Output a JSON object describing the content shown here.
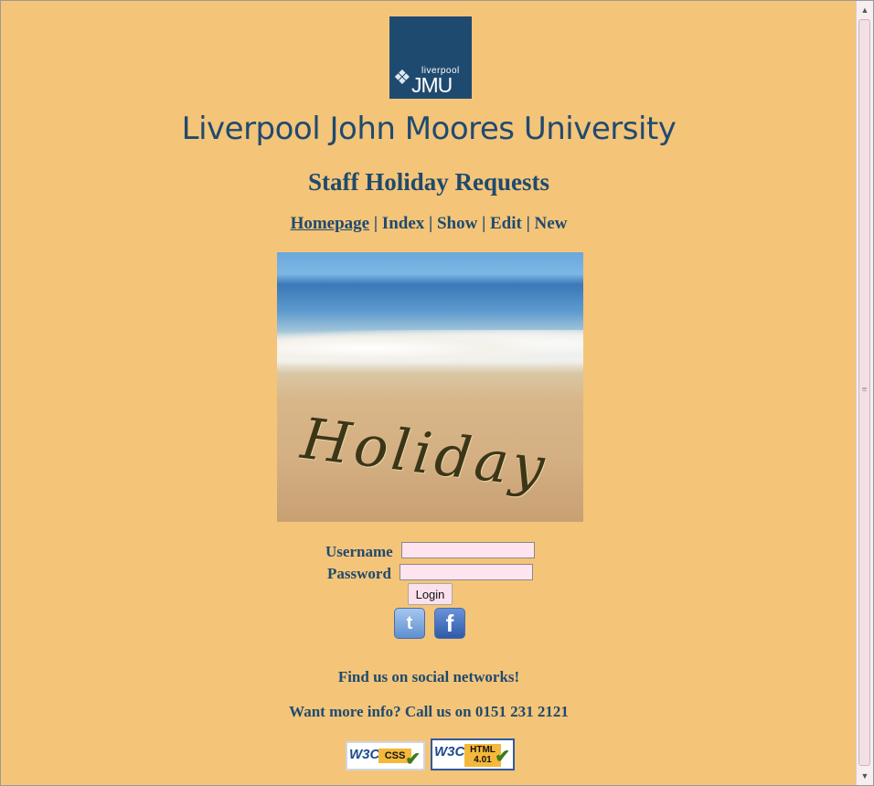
{
  "logo": {
    "small_text": "liverpool",
    "big_text": "JMU"
  },
  "university_title": "Liverpool John Moores University",
  "app_title": "Staff Holiday Requests",
  "nav": {
    "items": [
      "Homepage",
      "Index",
      "Show",
      "Edit",
      "New"
    ],
    "separator": "|",
    "active": "Homepage"
  },
  "hero": {
    "word": "Holiday"
  },
  "login": {
    "username_label": "Username",
    "password_label": "Password",
    "username_value": "",
    "password_value": "",
    "button_label": "Login"
  },
  "social": {
    "twitter_glyph": "t",
    "facebook_glyph": "f"
  },
  "find_us": "Find us on social networks!",
  "more_info": "Want more info? Call us on 0151 231 2121",
  "badges": {
    "css": {
      "w3c": "W3C",
      "text": "CSS"
    },
    "html": {
      "w3c": "W3C",
      "text_line1": "HTML",
      "text_line2": "4.01"
    }
  },
  "colors": {
    "background": "#f4c478",
    "text": "#1f4a6e",
    "input_bg": "#fde4ee"
  },
  "icons": [
    "jmu-logo-icon",
    "twitter-icon",
    "facebook-icon",
    "w3c-css-badge-icon",
    "w3c-html-badge-icon"
  ]
}
